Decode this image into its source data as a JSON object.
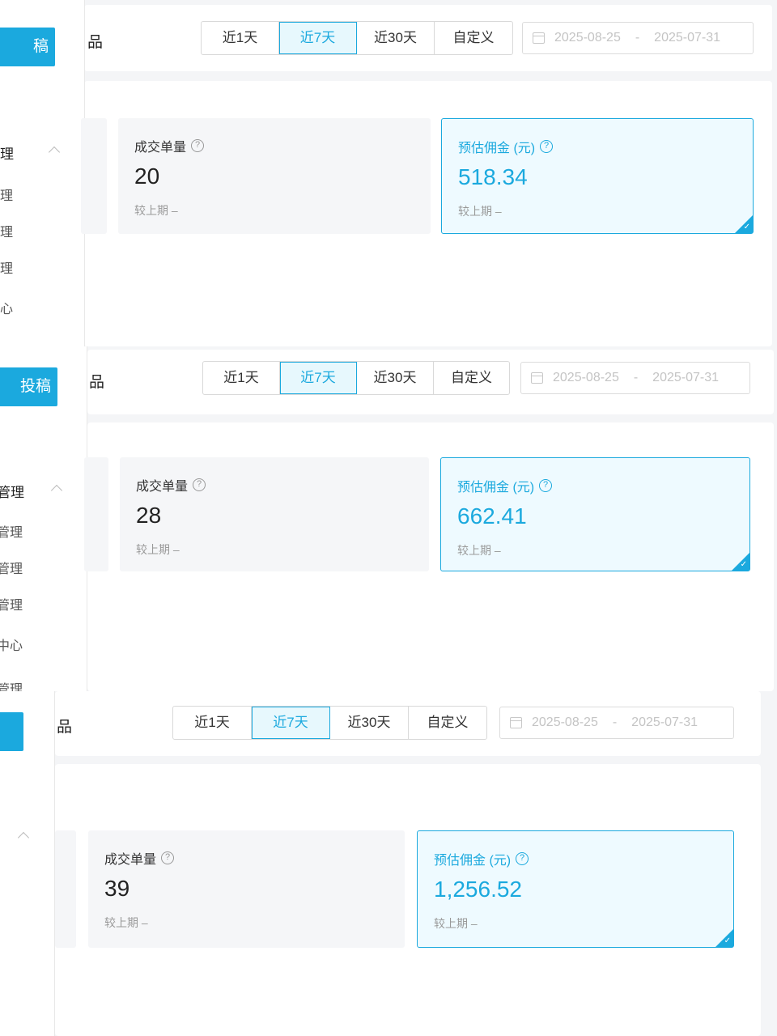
{
  "title_fragment": "品",
  "sidebar": {
    "button_fragments": [
      "稿",
      "投稿",
      ""
    ],
    "group_label": [
      "理",
      "管理"
    ],
    "items": [
      [
        "理",
        "理",
        "理",
        "心"
      ],
      [
        "管理",
        "管理",
        "管理",
        "中心",
        "管理"
      ]
    ]
  },
  "date_tabs": [
    "近1天",
    "近7天",
    "近30天",
    "自定义"
  ],
  "active_tab": "近7天",
  "date_range": {
    "start": "2025-08-25",
    "separator": "-",
    "end": "2025-07-31"
  },
  "metrics": {
    "orders_label": "成交单量",
    "commission_label": "预估佣金 (元)",
    "compare_label": "较上期",
    "compare_value": "–",
    "help_glyph": "?"
  },
  "panels": [
    {
      "orders": "20",
      "commission": "518.34"
    },
    {
      "orders": "28",
      "commission": "662.41"
    },
    {
      "orders": "39",
      "commission": "1,256.52"
    }
  ],
  "colors": {
    "accent": "#1ba9de",
    "card_bg": "#f5f6f8"
  }
}
